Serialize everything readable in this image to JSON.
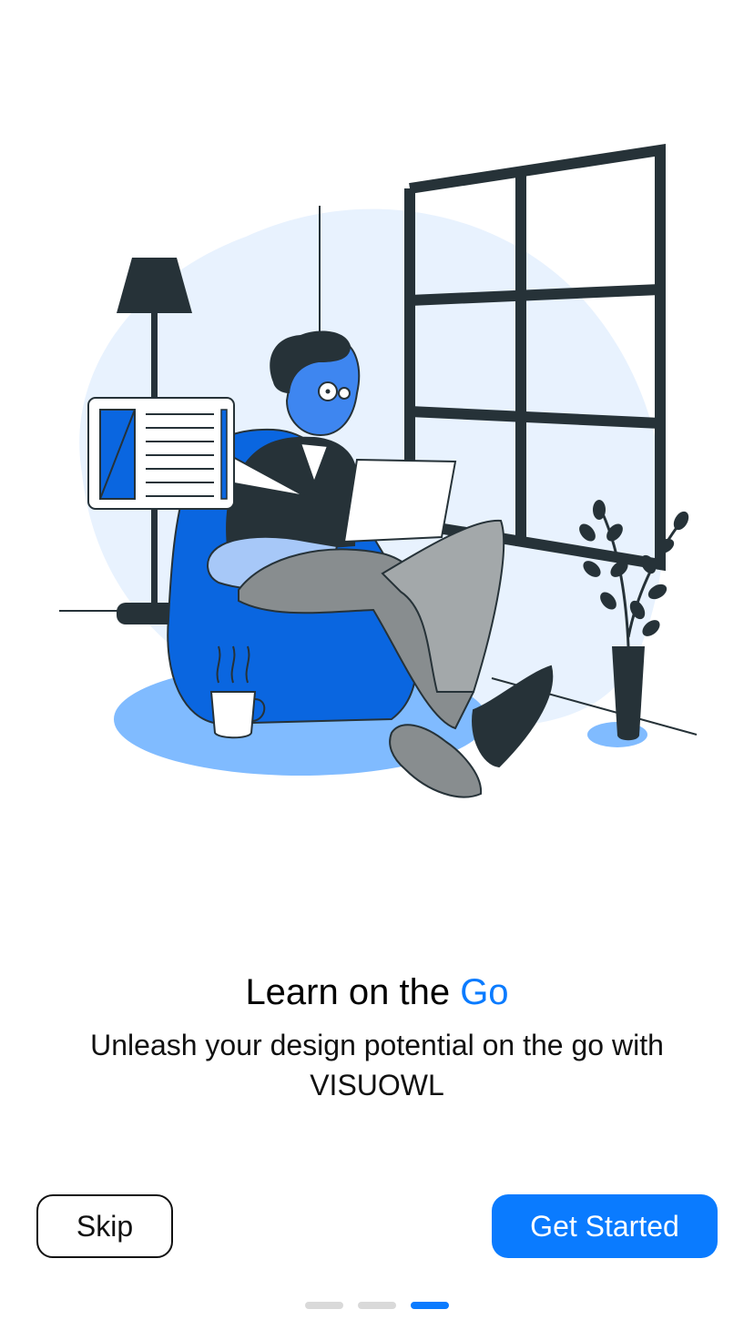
{
  "onboarding": {
    "title_prefix": "Learn on the ",
    "title_accent": "Go",
    "subtitle": "Unleash your design potential on the go with VISUOWL",
    "accent_color": "#0A7BFF"
  },
  "actions": {
    "skip_label": "Skip",
    "get_started_label": "Get Started"
  },
  "pagination": {
    "total_pages": 3,
    "current_page": 3
  }
}
